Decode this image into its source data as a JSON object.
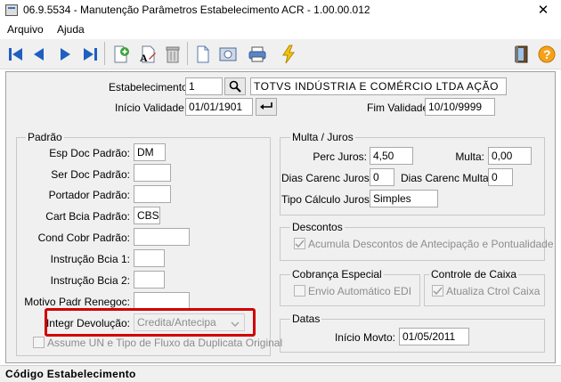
{
  "window": {
    "title": "06.9.5534 - Manutenção Parâmetros Estabelecimento ACR - 1.00.00.012",
    "close": "✕"
  },
  "menu": [
    "Arquivo",
    "Ajuda"
  ],
  "header": {
    "estabelecimento_label": "Estabelecimento:",
    "estabelecimento_value": "1",
    "empresa_nome": "TOTVS INDÚSTRIA E COMÉRCIO LTDA AÇÃO",
    "inicio_validade_label": "Início Validade:",
    "inicio_validade_value": "01/01/1901",
    "fim_validade_label": "Fim Validade:",
    "fim_validade_value": "10/10/9999"
  },
  "padrao": {
    "title": "Padrão",
    "esp_doc_label": "Esp Doc Padrão:",
    "esp_doc_value": "DM",
    "ser_doc_label": "Ser Doc Padrão:",
    "ser_doc_value": "",
    "portador_label": "Portador Padrão:",
    "portador_value": "",
    "cart_bcia_label": "Cart Bcia Padrão:",
    "cart_bcia_value": "CBS",
    "cond_cobr_label": "Cond Cobr Padrão:",
    "cond_cobr_value": "",
    "instr1_label": "Instrução Bcia 1:",
    "instr1_value": "",
    "instr2_label": "Instrução Bcia 2:",
    "instr2_value": "",
    "motivo_label": "Motivo Padr Renegoc:",
    "motivo_value": "",
    "integr_dev_label": "Integr Devolução:",
    "integr_dev_value": "Credita/Antecipa",
    "assume_un_label": "Assume UN e Tipo de Fluxo da Duplicata Original"
  },
  "multa_juros": {
    "title": "Multa / Juros",
    "perc_juros_label": "Perc Juros:",
    "perc_juros_value": "4,50",
    "multa_label": "Multa:",
    "multa_value": "0,00",
    "dias_carenc_juros_label": "Dias Carenc Juros:",
    "dias_carenc_juros_value": "0",
    "dias_carenc_multa_label": "Dias Carenc Multa:",
    "dias_carenc_multa_value": "0",
    "tipo_calculo_label": "Tipo Cálculo Juros:",
    "tipo_calculo_value": "Simples"
  },
  "descontos": {
    "title": "Descontos",
    "acumula_label": "Acumula Descontos de Antecipação e Pontualidade"
  },
  "cobranca": {
    "title": "Cobrança Especial",
    "envio_label": "Envio Automático EDI"
  },
  "controle_caixa": {
    "title": "Controle de Caixa",
    "atualiza_label": "Atualiza Ctrol Caixa"
  },
  "datas": {
    "title": "Datas",
    "inicio_movto_label": "Início Movto:",
    "inicio_movto_value": "01/05/2011"
  },
  "status": {
    "text": "Código Estabelecimento"
  },
  "colors": {
    "nav_blue": "#1f5fbf",
    "highlight_red": "#d10000"
  }
}
